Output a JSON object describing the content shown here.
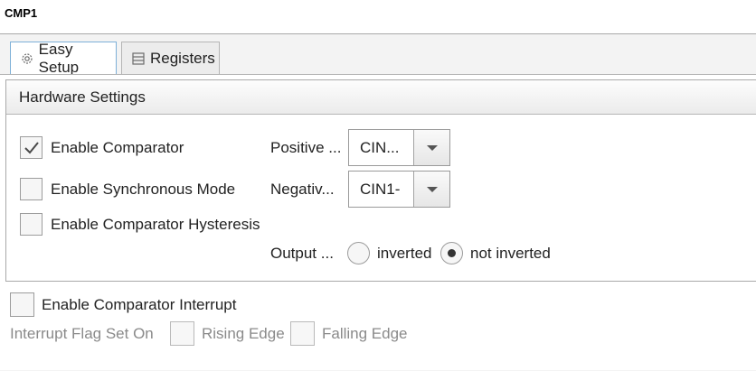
{
  "window": {
    "title": "CMP1"
  },
  "tabs": [
    {
      "label": "Easy Setup",
      "icon": "gear-icon",
      "active": true
    },
    {
      "label": "Registers",
      "icon": "list-icon",
      "active": false
    }
  ],
  "hardware": {
    "title": "Hardware Settings",
    "enable_comparator": {
      "label": "Enable Comparator",
      "checked": true
    },
    "enable_sync_mode": {
      "label": "Enable Synchronous Mode",
      "checked": false
    },
    "enable_hysteresis": {
      "label": "Enable Comparator Hysteresis",
      "checked": false
    },
    "positive_input": {
      "label": "Positive ...",
      "value": "CIN..."
    },
    "negative_input": {
      "label": "Negativ...",
      "value": "CIN1-"
    },
    "output_polarity": {
      "label": "Output ...",
      "options": [
        "inverted",
        "not inverted"
      ],
      "selected": "not inverted"
    }
  },
  "interrupt": {
    "enable": {
      "label": "Enable Comparator Interrupt",
      "checked": false
    },
    "flag_label": "Interrupt Flag Set On",
    "rising_edge": {
      "label": "Rising Edge",
      "checked": false
    },
    "falling_edge": {
      "label": "Falling Edge",
      "checked": false
    }
  },
  "colors": {
    "tab_active_border": "#7eb0d8",
    "disabled_text": "#8a8a8a"
  }
}
